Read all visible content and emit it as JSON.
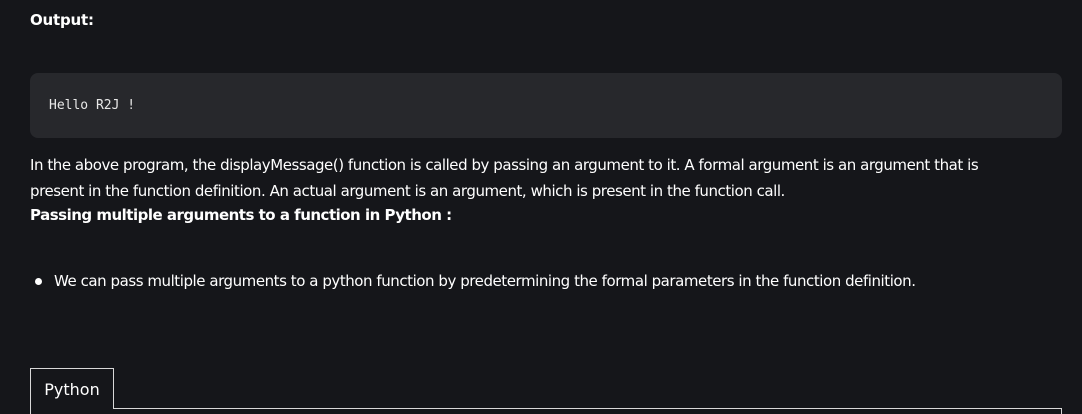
{
  "output_section": {
    "heading": "Output:",
    "code_output": "Hello R2J !"
  },
  "article": {
    "paragraph_line1": "In the above program, the displayMessage() function is called by passing an argument to it. A formal argument is an argument that is",
    "paragraph_line2": "present in the function definition. An actual argument is an argument, which is present in the function call.",
    "subheading": "Passing multiple arguments to a function in Python :",
    "bullets": [
      "We can pass multiple arguments to a python function by predetermining the formal parameters in the function definition."
    ]
  },
  "code_tabs": {
    "active_tab_label": "Python"
  },
  "colors": {
    "background": "#15161a",
    "output_box": "#27282c",
    "text": "#ffffff"
  }
}
